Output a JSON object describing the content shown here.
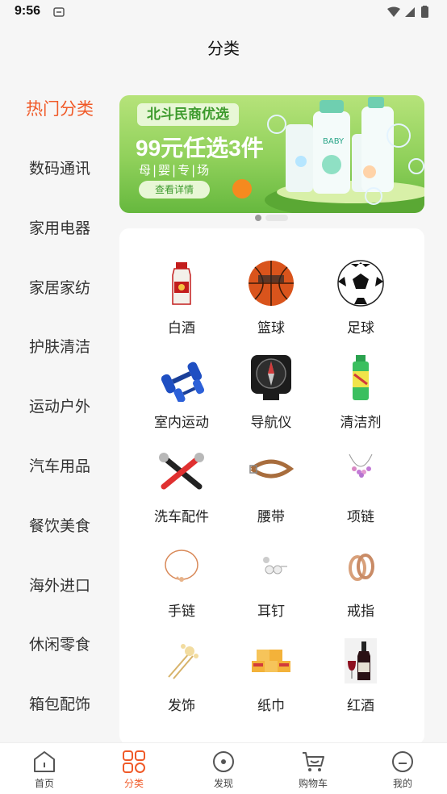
{
  "status_bar": {
    "time": "9:56"
  },
  "header": {
    "title": "分类"
  },
  "sidebar": {
    "items": [
      {
        "label": "热门分类",
        "active": true
      },
      {
        "label": "数码通讯"
      },
      {
        "label": "家用电器"
      },
      {
        "label": "家居家纺"
      },
      {
        "label": "护肤清洁"
      },
      {
        "label": "运动户外"
      },
      {
        "label": "汽车用品"
      },
      {
        "label": "餐饮美食"
      },
      {
        "label": "海外进口"
      },
      {
        "label": "休闲零食"
      },
      {
        "label": "箱包配饰"
      }
    ]
  },
  "banner": {
    "tag": "北斗民商优选",
    "title": "99元任选3件",
    "subtitle": "母|婴|专|场",
    "button": "查看详情",
    "bottle_label": "BABY"
  },
  "grid": {
    "items": [
      {
        "label": "白酒",
        "icon": "baijiu-icon"
      },
      {
        "label": "篮球",
        "icon": "basketball-icon"
      },
      {
        "label": "足球",
        "icon": "football-icon"
      },
      {
        "label": "室内运动",
        "icon": "dumbbell-icon"
      },
      {
        "label": "导航仪",
        "icon": "compass-icon"
      },
      {
        "label": "清洁剂",
        "icon": "spray-icon"
      },
      {
        "label": "洗车配件",
        "icon": "wrench-icon"
      },
      {
        "label": "腰带",
        "icon": "belt-icon"
      },
      {
        "label": "项链",
        "icon": "necklace-icon"
      },
      {
        "label": "手链",
        "icon": "bracelet-icon"
      },
      {
        "label": "耳钉",
        "icon": "earring-icon"
      },
      {
        "label": "戒指",
        "icon": "ring-icon"
      },
      {
        "label": "发饰",
        "icon": "hairpin-icon"
      },
      {
        "label": "纸巾",
        "icon": "tissue-icon"
      },
      {
        "label": "红酒",
        "icon": "wine-icon"
      }
    ]
  },
  "tabbar": {
    "items": [
      {
        "label": "首页",
        "icon": "home-icon"
      },
      {
        "label": "分类",
        "icon": "category-icon",
        "active": true
      },
      {
        "label": "发现",
        "icon": "discover-icon"
      },
      {
        "label": "购物车",
        "icon": "cart-icon"
      },
      {
        "label": "我的",
        "icon": "profile-icon"
      }
    ]
  },
  "colors": {
    "accent": "#f05a28",
    "banner_green": "#8fd05a"
  }
}
